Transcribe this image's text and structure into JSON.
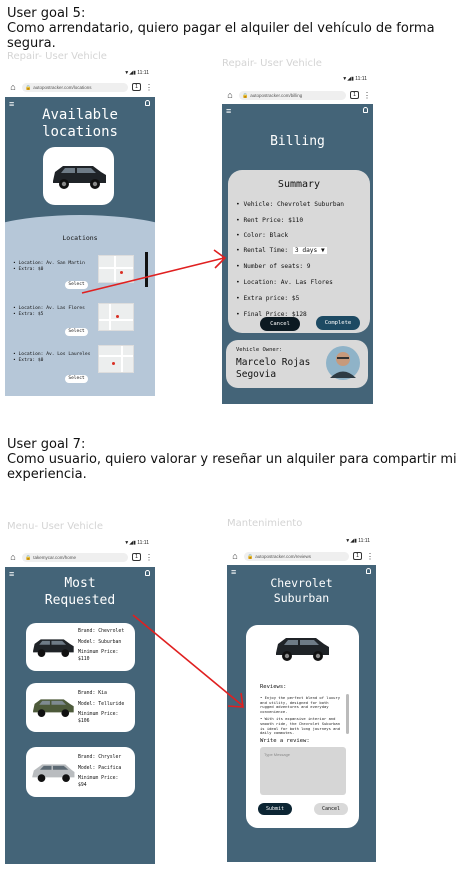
{
  "goal5": {
    "heading": "User goal 5:",
    "line1": "Como arrendatario, quiero pagar el alquiler del vehículo de forma",
    "line2": "segura."
  },
  "goal7": {
    "heading": "User goal 7:",
    "line1": "Como usuario, quiero valorar y reseñar un alquiler para compartir mi",
    "line2": "experiencia."
  },
  "frames": {
    "f1": "Repair- User Vehicle",
    "f2": "Repair- User Vehicle",
    "f3": "Menu- User Vehicle",
    "f4": "Mantenimiento"
  },
  "locations_screen": {
    "time": "11:11",
    "url": "autopostracker.com/locations",
    "tab_count": "1",
    "title_line1": "Available",
    "title_line2": "locations",
    "section_title": "Locations",
    "items": [
      {
        "location": "• Location: Av. San Martin",
        "extra": "• Extra: $0",
        "select": "Select"
      },
      {
        "location": "• Location: Av. Las Flores",
        "extra": "• Extra: $5",
        "select": "Select"
      },
      {
        "location": "• Location: Av. Los Laureles",
        "extra": "• Extra: $0",
        "select": "Select"
      }
    ]
  },
  "billing_screen": {
    "time": "11:11",
    "url": "autopostracker.com/billing",
    "tab_count": "1",
    "title": "Billing",
    "summary_title": "Summary",
    "vehicle": "• Vehicle: Chevrolet Suburban",
    "rent_price": "• Rent Price: $110",
    "color": "• Color: Black",
    "rental_time_label": "• Rental Time:",
    "rental_time_value": "3 days",
    "seats": "• Number of seats: 9",
    "location": "• Location: Av. Las Flores",
    "extra_price": "• Extra price: $5",
    "final_price": "• Final Price: $128",
    "cancel": "Cancel",
    "complete": "Complete",
    "owner_label": "Vehicle Owner:",
    "owner_name_1": "Marcelo Rojas",
    "owner_name_2": "Segovia"
  },
  "requested_screen": {
    "time": "11:11",
    "url": "takemycar.com/home",
    "tab_count": "1",
    "title_line1": "Most",
    "title_line2": "Requested",
    "cars": [
      {
        "brand": "Brand: Chevrolet",
        "model": "Model: Suburban",
        "min_label": "Minimum Price:",
        "min_value": "$110"
      },
      {
        "brand": "Brand: Kia",
        "model": "Model: Telluride",
        "min_label": "Minimum Price:",
        "min_value": "$106"
      },
      {
        "brand": "Brand: Chrysler",
        "model": "Model: Pacifica",
        "min_label": "Minimum Price:",
        "min_value": "$94"
      }
    ]
  },
  "review_screen": {
    "time": "11:11",
    "url": "autopostracker.com/reviews",
    "tab_count": "1",
    "title_line1": "Chevrolet",
    "title_line2": "Suburban",
    "reviews_label": "Reviews:",
    "review1": "• Enjoy the perfect blend of luxury and utility, designed for both rugged adventures and everyday convenience.",
    "review2": "• With its expansive interior and smooth ride, the Chevrolet Suburban is ideal for both long journeys and daily commutes.",
    "write_label": "Write a review:",
    "placeholder": "Type Message",
    "submit": "Submit",
    "cancel": "Cancel"
  },
  "colors": {
    "screen_bg": "#446478",
    "card_bg": "#d9d9d9",
    "dark_button": "#0c2533",
    "arrow": "#e02020"
  }
}
